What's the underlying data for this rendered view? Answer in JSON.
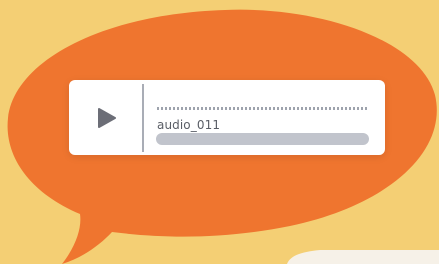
{
  "colors": {
    "background": "#f4cf74",
    "bubble": "#ef752f",
    "card": "#ffffff",
    "play_icon": "#6c6e77",
    "track": "#c1c4cc"
  },
  "player": {
    "play_icon": "play-icon",
    "filename": "audio_011",
    "progress": 0
  }
}
